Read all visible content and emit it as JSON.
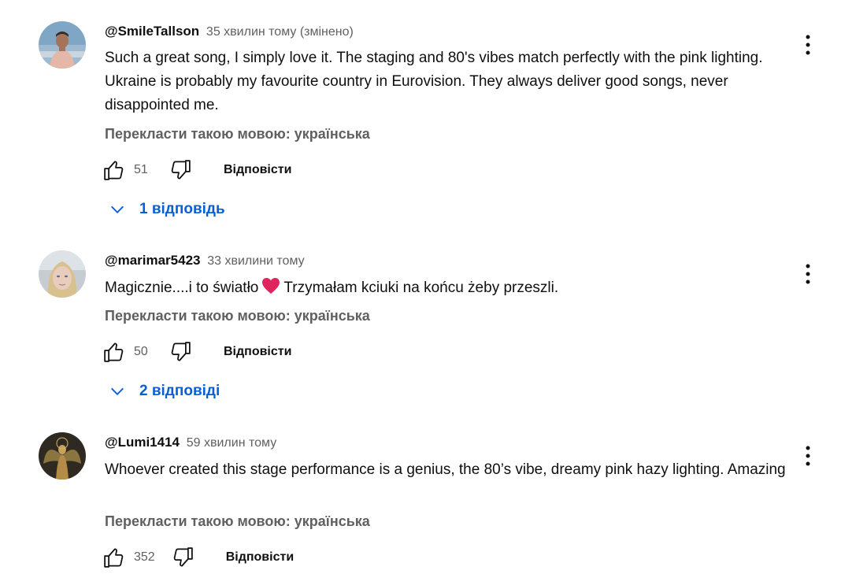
{
  "comments": [
    {
      "author": "@SmileTallson",
      "time": "35 хвилин тому (змінено)",
      "text": "Such a great song, I simply love it. The staging and 80's vibes match perfectly with the pink lighting. Ukraine is probably my favourite country in Eurovision. They always deliver good songs, never disappointed me.",
      "translate": "Перекласти такою мовою: українська",
      "likes": "51",
      "reply_label": "Відповісти",
      "replies_label": "1 відповідь",
      "avatar_icon": "profile-photo-man"
    },
    {
      "author": "@marimar5423",
      "time": "33 хвилини тому",
      "text_before": "Magicznie....i to światło",
      "text_after": "Trzymałam kciuki na końcu żeby przeszli.",
      "emoji": "red-heart",
      "translate": "Перекласти такою мовою: українська",
      "likes": "50",
      "reply_label": "Відповісти",
      "replies_label": "2 відповіді",
      "avatar_icon": "profile-photo-woman"
    },
    {
      "author": "@Lumi1414",
      "time": "59 хвилин тому",
      "text": "Whoever created this stage performance is a genius, the 80’s vibe, dreamy pink hazy lighting. Amazing",
      "translate": "Перекласти такою мовою: українська",
      "likes": "352",
      "reply_label": "Відповісти",
      "avatar_icon": "profile-photo-angel"
    }
  ],
  "colors": {
    "link_blue": "#065fd4",
    "secondary_text": "#606060",
    "primary_text": "#0f0f0f",
    "heart": "#e0245e"
  }
}
